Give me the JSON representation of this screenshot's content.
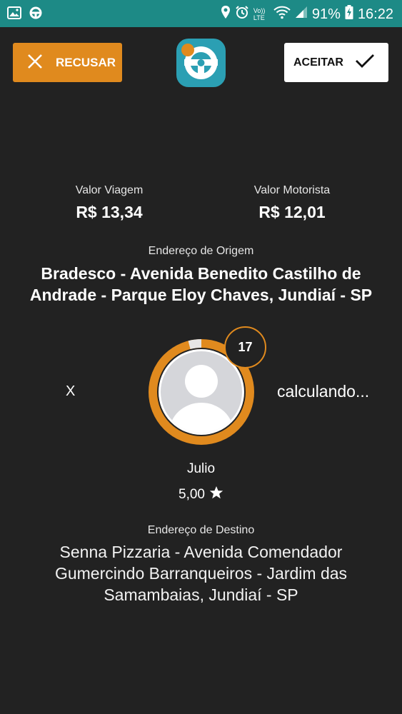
{
  "status_bar": {
    "battery": "91%",
    "time": "16:22",
    "volte": "Vo)) LTE"
  },
  "actions": {
    "refuse_label": "RECUSAR",
    "accept_label": "ACEITAR"
  },
  "fare": {
    "trip_label": "Valor Viagem",
    "trip_value": "R$ 13,34",
    "driver_label": "Valor Motorista",
    "driver_value": "R$ 12,01"
  },
  "origin": {
    "label": "Endereço de Origem",
    "address": "Bradesco - Avenida Benedito Castilho de Andrade - Parque Eloy Chaves, Jundiaí - SP"
  },
  "passenger": {
    "left_text": "X",
    "right_text": "calculando...",
    "countdown": "17",
    "countdown_progress": 0.96,
    "name": "Julio",
    "rating": "5,00"
  },
  "destination": {
    "label": "Endereço de Destino",
    "address": "Senna Pizzaria - Avenida Comendador Gumercindo Barranqueiros - Jardim das Samambaias, Jundiaí - SP"
  },
  "colors": {
    "status_bar": "#1d8a86",
    "background": "#222222",
    "accent_orange": "#e08a1e",
    "accept_bg": "#ffffff"
  }
}
